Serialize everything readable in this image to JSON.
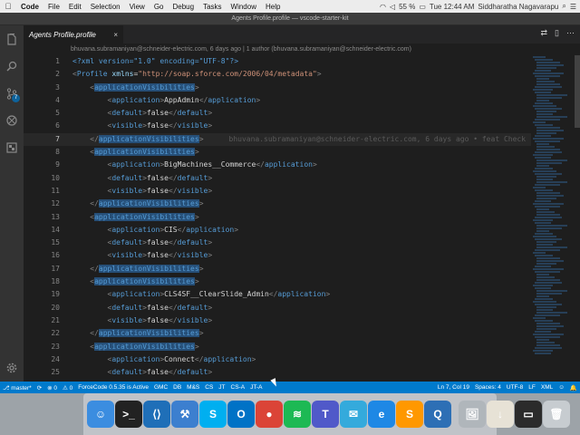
{
  "menubar": {
    "apple_icon": "apple-icon",
    "app_name": "Code",
    "items": [
      "File",
      "Edit",
      "Selection",
      "View",
      "Go",
      "Debug",
      "Tasks",
      "Window",
      "Help"
    ],
    "battery": "55 %",
    "clock": "Tue 12:44 AM",
    "user": "Siddharatha Nagavarapu"
  },
  "window": {
    "title": "Agents Profile.profile — vscode-starter-kit"
  },
  "tab": {
    "label": "Agents Profile.profile",
    "close": "×"
  },
  "tab_actions": [
    "⇄",
    "▯",
    "⋯"
  ],
  "blame_header": "bhuvana.subramaniyan@schneider-electric.com, 6 days ago | 1 author (bhuvana.subramaniyan@schneider-electric.com)",
  "editor": {
    "current_line": 7,
    "inline_blame": "bhuvana.subramaniyan@schneider-electric.com, 6 days ago • feat Check",
    "lines": [
      {
        "n": "1",
        "indent": 0,
        "kind": "pi"
      },
      {
        "n": "2",
        "indent": 0,
        "kind": "root"
      },
      {
        "n": "3",
        "indent": 1,
        "kind": "open",
        "tag": "applicationVisibilities"
      },
      {
        "n": "4",
        "indent": 2,
        "kind": "elem",
        "tag": "application",
        "val": "AppAdmin"
      },
      {
        "n": "5",
        "indent": 2,
        "kind": "elem",
        "tag": "default",
        "val": "false"
      },
      {
        "n": "6",
        "indent": 2,
        "kind": "elem",
        "tag": "visible",
        "val": "false"
      },
      {
        "n": "7",
        "indent": 1,
        "kind": "close",
        "tag": "applicationVisibilities"
      },
      {
        "n": "8",
        "indent": 1,
        "kind": "open",
        "tag": "applicationVisibilities"
      },
      {
        "n": "9",
        "indent": 2,
        "kind": "elem",
        "tag": "application",
        "val": "BigMachines__Commerce"
      },
      {
        "n": "10",
        "indent": 2,
        "kind": "elem",
        "tag": "default",
        "val": "false"
      },
      {
        "n": "11",
        "indent": 2,
        "kind": "elem",
        "tag": "visible",
        "val": "false"
      },
      {
        "n": "12",
        "indent": 1,
        "kind": "close",
        "tag": "applicationVisibilities"
      },
      {
        "n": "13",
        "indent": 1,
        "kind": "open",
        "tag": "applicationVisibilities"
      },
      {
        "n": "14",
        "indent": 2,
        "kind": "elem",
        "tag": "application",
        "val": "CIS"
      },
      {
        "n": "15",
        "indent": 2,
        "kind": "elem",
        "tag": "default",
        "val": "false"
      },
      {
        "n": "16",
        "indent": 2,
        "kind": "elem",
        "tag": "visible",
        "val": "false"
      },
      {
        "n": "17",
        "indent": 1,
        "kind": "close",
        "tag": "applicationVisibilities"
      },
      {
        "n": "18",
        "indent": 1,
        "kind": "open",
        "tag": "applicationVisibilities"
      },
      {
        "n": "19",
        "indent": 2,
        "kind": "elem",
        "tag": "application",
        "val": "CLS4SF__ClearSlide_Admin"
      },
      {
        "n": "20",
        "indent": 2,
        "kind": "elem",
        "tag": "default",
        "val": "false"
      },
      {
        "n": "21",
        "indent": 2,
        "kind": "elem",
        "tag": "visible",
        "val": "false"
      },
      {
        "n": "22",
        "indent": 1,
        "kind": "close",
        "tag": "applicationVisibilities"
      },
      {
        "n": "23",
        "indent": 1,
        "kind": "open",
        "tag": "applicationVisibilities"
      },
      {
        "n": "24",
        "indent": 2,
        "kind": "elem",
        "tag": "application",
        "val": "Connect"
      },
      {
        "n": "25",
        "indent": 2,
        "kind": "elem",
        "tag": "default",
        "val": "false"
      }
    ],
    "pi_text": "<?xml version=\"1.0\" encoding=\"UTF-8\"?>",
    "root_tag": "Profile",
    "root_attr": "xmlns",
    "root_attr_val": "\"http://soap.sforce.com/2006/04/metadata\""
  },
  "activity_icons": [
    "files-icon",
    "search-icon",
    "source-control-icon",
    "debug-icon",
    "extensions-icon",
    "settings-icon"
  ],
  "scm_badge": "7",
  "status": {
    "branch": "master*",
    "sync": "⟳",
    "errors": "⊗ 0",
    "warnings": "⚠ 0",
    "forcecode": "ForceCode 0.5.35 is Active",
    "items": [
      "GMC",
      "DB",
      "M&S",
      "CS",
      "JT",
      "CS-A",
      "JT-A"
    ],
    "position": "Ln 7, Col 19",
    "spaces": "Spaces: 4",
    "encoding": "UTF-8",
    "eol": "LF",
    "language": "XML",
    "smiley": "☺",
    "bell": "🔔"
  },
  "dock": {
    "apps": [
      {
        "name": "finder-icon",
        "glyph": "☺",
        "color": "#3b8de0"
      },
      {
        "name": "terminal-icon",
        "glyph": ">_",
        "color": "#222222"
      },
      {
        "name": "vscode-icon",
        "glyph": "⟨⟩",
        "color": "#1f6fb8"
      },
      {
        "name": "xcode-icon",
        "glyph": "⚒",
        "color": "#3c7fcf"
      },
      {
        "name": "skype-icon",
        "glyph": "S",
        "color": "#00aff0"
      },
      {
        "name": "outlook-icon",
        "glyph": "O",
        "color": "#0072c6"
      },
      {
        "name": "chrome-icon",
        "glyph": "●",
        "color": "#db4437"
      },
      {
        "name": "spotify-icon",
        "glyph": "≋",
        "color": "#1db954"
      },
      {
        "name": "teams-icon",
        "glyph": "T",
        "color": "#5059c9"
      },
      {
        "name": "messages-icon",
        "glyph": "✉",
        "color": "#34aadc"
      },
      {
        "name": "ie-icon",
        "glyph": "e",
        "color": "#1e88e5"
      },
      {
        "name": "sublime-icon",
        "glyph": "S",
        "color": "#ff9800"
      },
      {
        "name": "quicktime-icon",
        "glyph": "Q",
        "color": "#2d6fb5"
      },
      {
        "name": "preview-icon",
        "glyph": "🖼",
        "color": "#b0b6bb"
      },
      {
        "name": "downloads-icon",
        "glyph": "↓",
        "color": "#e7e2d6"
      },
      {
        "name": "screen-icon",
        "glyph": "▭",
        "color": "#2b2b2b"
      },
      {
        "name": "trash-icon",
        "glyph": "🗑",
        "color": "#c7ccd0"
      }
    ]
  }
}
